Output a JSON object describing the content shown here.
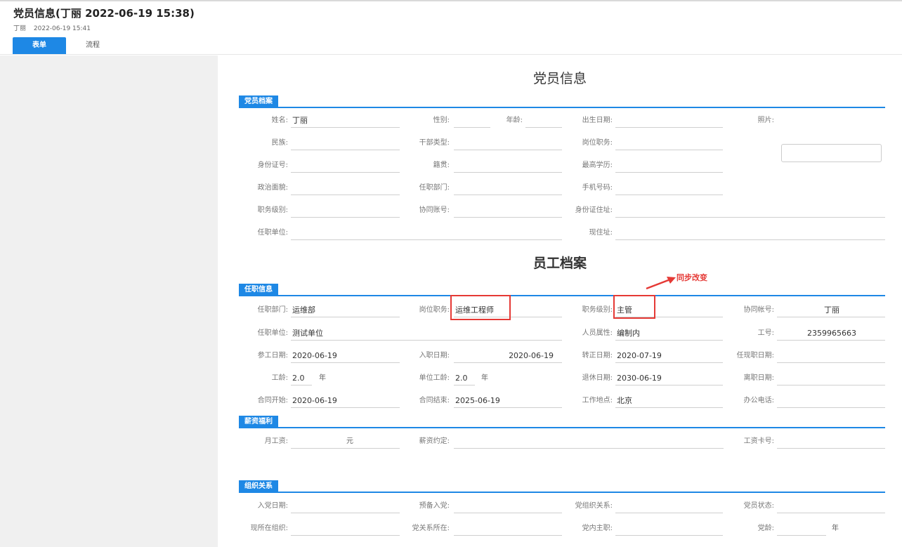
{
  "header": {
    "title": "党员信息(丁丽 2022-06-19 15:38)",
    "author": "丁丽",
    "timestamp": "2022-06-19 15:41",
    "tabs": [
      {
        "label": "表单",
        "active": true
      },
      {
        "label": "流程",
        "active": false
      }
    ]
  },
  "form": {
    "title": "党员信息",
    "party_section": {
      "label": "党员档案",
      "name_label": "姓名:",
      "name_value": "丁丽",
      "gender_label": "性别:",
      "gender_value": "",
      "age_label": "年龄:",
      "age_value": "",
      "birth_label": "出生日期:",
      "birth_value": "",
      "photo_label": "照片:",
      "nation_label": "民族:",
      "nation_value": "",
      "cadre_label": "干部类型:",
      "cadre_value": "",
      "post_label": "岗位职务:",
      "post_value": "",
      "idno_label": "身份证号:",
      "idno_value": "",
      "native_label": "籍贯:",
      "native_value": "",
      "edu_label": "最高学历:",
      "edu_value": "",
      "political_label": "政治面貌:",
      "political_value": "",
      "dept_label": "任职部门:",
      "dept_value": "",
      "phone_label": "手机号码:",
      "phone_value": "",
      "level_label": "职务级别:",
      "level_value": "",
      "account_label": "协同账号:",
      "account_value": "",
      "idaddr_label": "身份证住址:",
      "idaddr_value": "",
      "unit_label": "任职单位:",
      "unit_value": "",
      "addr_label": "现住址:",
      "addr_value": ""
    },
    "employee_title": "员工档案",
    "job_section": {
      "label": "任职信息",
      "dept_label": "任职部门:",
      "dept_value": "运维部",
      "post_label": "岗位职务:",
      "post_value": "运维工程师",
      "level_label": "职务级别:",
      "level_value": "主管",
      "account_label": "协同帐号:",
      "account_value": "丁丽",
      "unit_label": "任职单位:",
      "unit_value": "测试单位",
      "attr_label": "人员属性:",
      "attr_value": "编制内",
      "jobno_label": "工号:",
      "jobno_value": "2359965663",
      "workdate_label": "参工日期:",
      "workdate_value": "2020-06-19",
      "joindate_label": "入职日期:",
      "joindate_value": "2020-06-19",
      "regular_label": "转正日期:",
      "regular_value": "2020-07-19",
      "curpost_label": "任现职日期:",
      "curpost_value": "",
      "seniority_label": "工龄:",
      "seniority_value": "2.0",
      "unitsen_label": "单位工龄:",
      "unitsen_value": "2.0",
      "year_unit": "年",
      "retire_label": "退休日期:",
      "retire_value": "2030-06-19",
      "leave_label": "离职日期:",
      "leave_value": "",
      "cstart_label": "合同开始:",
      "cstart_value": "2020-06-19",
      "cend_label": "合同结束:",
      "cend_value": "2025-06-19",
      "place_label": "工作地点:",
      "place_value": "北京",
      "office_label": "办公电话:",
      "office_value": ""
    },
    "annotation": "同步改变",
    "salary_section": {
      "label": "薪资福利",
      "wage_label": "月工资:",
      "wage_value": "",
      "wage_unit": "元",
      "agree_label": "薪资约定:",
      "agree_value": "",
      "card_label": "工资卡号:",
      "card_value": ""
    },
    "org_section": {
      "label": "组织关系",
      "join_label": "入党日期:",
      "join_value": "",
      "prep_label": "预备入党:",
      "prep_value": "",
      "rel_label": "党组织关系:",
      "rel_value": "",
      "status_label": "党员状态:",
      "status_value": "",
      "cur_label": "现所在组织:",
      "cur_value": "",
      "loc_label": "党关系所在:",
      "loc_value": "",
      "duty_label": "党内主职:",
      "duty_value": "",
      "age_label": "党龄:",
      "age_value": "",
      "age_unit": "年"
    }
  },
  "colors": {
    "accent": "#1e88e5",
    "highlight": "#e53935",
    "panel": "#f0f0f0"
  }
}
